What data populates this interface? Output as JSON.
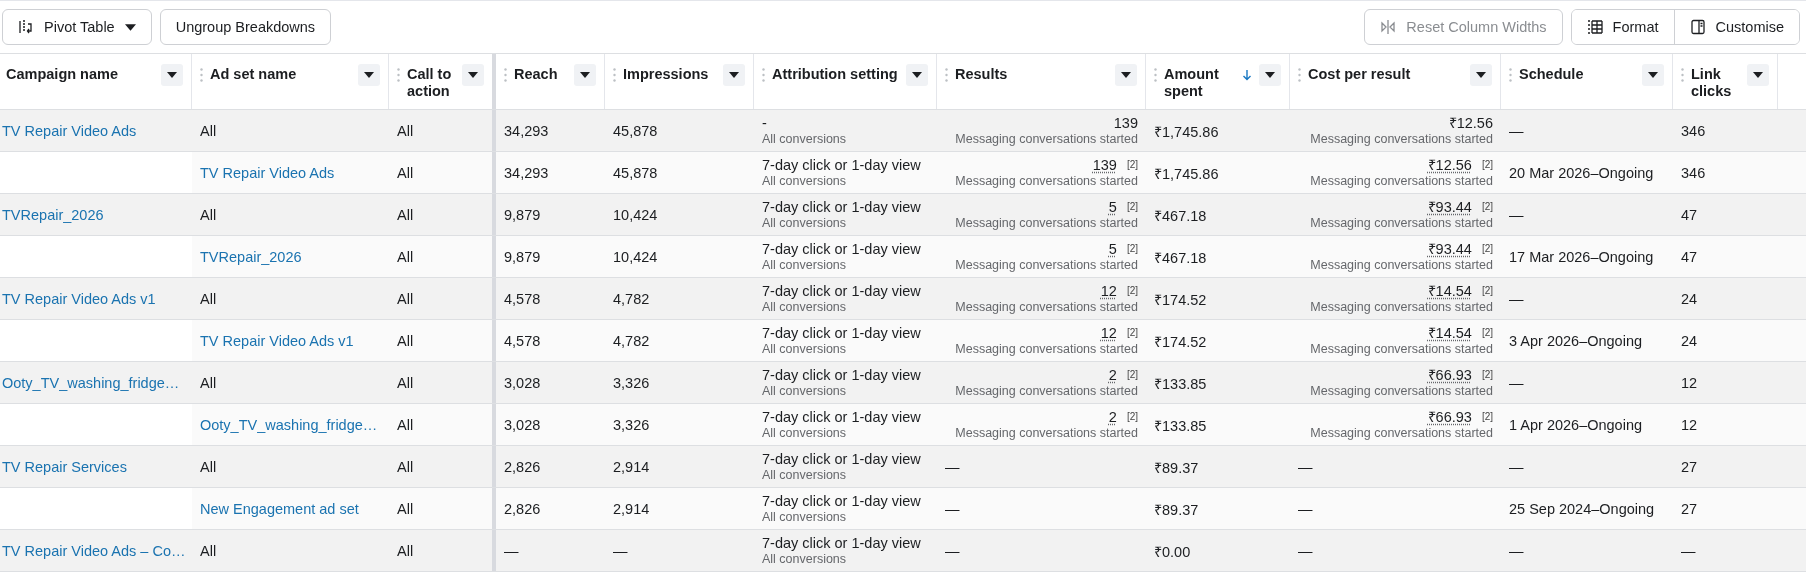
{
  "toolbar": {
    "pivot_button": "Pivot Table",
    "ungroup_button": "Ungroup Breakdowns",
    "reset_button": {
      "label": "Reset Column Widths",
      "disabled": true
    },
    "format_button": "Format",
    "customise_button": "Customise"
  },
  "table": {
    "columns": [
      {
        "label": "Campaign name",
        "sorted": false
      },
      {
        "label": "Ad set name",
        "sorted": false
      },
      {
        "label": "Call to action",
        "sorted": false
      },
      {
        "label": "Reach",
        "sorted": false
      },
      {
        "label": "Impressions",
        "sorted": false
      },
      {
        "label": "Attribution setting",
        "sorted": false
      },
      {
        "label": "Results",
        "sorted": false
      },
      {
        "label": "Amount spent",
        "sorted": true
      },
      {
        "label": "Cost per result",
        "sorted": false
      },
      {
        "label": "Schedule",
        "sorted": false
      },
      {
        "label": "Link clicks",
        "sorted": false
      }
    ],
    "rows": [
      {
        "kind": "campaign",
        "campaign": "TV Repair Video Ads",
        "ad_set": "All",
        "call_to_action": "All",
        "reach": "34,293",
        "impressions": "45,878",
        "attribution": {
          "value": "-",
          "caption": "All conversions"
        },
        "results": {
          "value": "139",
          "caption": "Messaging conversations started"
        },
        "amount_spent": "₹1,745.86",
        "cost_per_result": {
          "value": "₹12.56",
          "caption": "Messaging conversations started"
        },
        "schedule": "—",
        "link_clicks": "346"
      },
      {
        "kind": "ad_set",
        "ad_set": "TV Repair Video Ads",
        "call_to_action": "All",
        "reach": "34,293",
        "impressions": "45,878",
        "attribution": {
          "value": "7-day click or 1-day view",
          "caption": "All conversions"
        },
        "results": {
          "value": "139",
          "footnote": "[2]",
          "caption": "Messaging conversations started"
        },
        "amount_spent": "₹1,745.86",
        "cost_per_result": {
          "value": "₹12.56",
          "footnote": "[2]",
          "caption": "Messaging conversations started"
        },
        "schedule": "20 Mar 2026–Ongoing",
        "link_clicks": "346"
      },
      {
        "kind": "campaign",
        "campaign": "TVRepair_2026",
        "ad_set": "All",
        "call_to_action": "All",
        "reach": "9,879",
        "impressions": "10,424",
        "attribution": {
          "value": "7-day click or 1-day view",
          "caption": "All conversions"
        },
        "results": {
          "value": "5",
          "footnote": "[2]",
          "caption": "Messaging conversations started"
        },
        "amount_spent": "₹467.18",
        "cost_per_result": {
          "value": "₹93.44",
          "footnote": "[2]",
          "caption": "Messaging conversations started"
        },
        "schedule": "—",
        "link_clicks": "47"
      },
      {
        "kind": "ad_set",
        "ad_set": "TVRepair_2026",
        "call_to_action": "All",
        "reach": "9,879",
        "impressions": "10,424",
        "attribution": {
          "value": "7-day click or 1-day view",
          "caption": "All conversions"
        },
        "results": {
          "value": "5",
          "footnote": "[2]",
          "caption": "Messaging conversations started"
        },
        "amount_spent": "₹467.18",
        "cost_per_result": {
          "value": "₹93.44",
          "footnote": "[2]",
          "caption": "Messaging conversations started"
        },
        "schedule": "17 Mar 2026–Ongoing",
        "link_clicks": "47"
      },
      {
        "kind": "campaign",
        "campaign": "TV Repair Video Ads v1",
        "ad_set": "All",
        "call_to_action": "All",
        "reach": "4,578",
        "impressions": "4,782",
        "attribution": {
          "value": "7-day click or 1-day view",
          "caption": "All conversions"
        },
        "results": {
          "value": "12",
          "footnote": "[2]",
          "caption": "Messaging conversations started"
        },
        "amount_spent": "₹174.52",
        "cost_per_result": {
          "value": "₹14.54",
          "footnote": "[2]",
          "caption": "Messaging conversations started"
        },
        "schedule": "—",
        "link_clicks": "24"
      },
      {
        "kind": "ad_set",
        "ad_set": "TV Repair Video Ads v1",
        "call_to_action": "All",
        "reach": "4,578",
        "impressions": "4,782",
        "attribution": {
          "value": "7-day click or 1-day view",
          "caption": "All conversions"
        },
        "results": {
          "value": "12",
          "footnote": "[2]",
          "caption": "Messaging conversations started"
        },
        "amount_spent": "₹174.52",
        "cost_per_result": {
          "value": "₹14.54",
          "footnote": "[2]",
          "caption": "Messaging conversations started"
        },
        "schedule": "3 Apr 2026–Ongoing",
        "link_clicks": "24"
      },
      {
        "kind": "campaign",
        "campaign": "Ooty_TV_washing_fridge…",
        "ad_set": "All",
        "call_to_action": "All",
        "reach": "3,028",
        "impressions": "3,326",
        "attribution": {
          "value": "7-day click or 1-day view",
          "caption": "All conversions"
        },
        "results": {
          "value": "2",
          "footnote": "[2]",
          "caption": "Messaging conversations started"
        },
        "amount_spent": "₹133.85",
        "cost_per_result": {
          "value": "₹66.93",
          "footnote": "[2]",
          "caption": "Messaging conversations started"
        },
        "schedule": "—",
        "link_clicks": "12"
      },
      {
        "kind": "ad_set",
        "ad_set": "Ooty_TV_washing_fridge…",
        "call_to_action": "All",
        "reach": "3,028",
        "impressions": "3,326",
        "attribution": {
          "value": "7-day click or 1-day view",
          "caption": "All conversions"
        },
        "results": {
          "value": "2",
          "footnote": "[2]",
          "caption": "Messaging conversations started"
        },
        "amount_spent": "₹133.85",
        "cost_per_result": {
          "value": "₹66.93",
          "footnote": "[2]",
          "caption": "Messaging conversations started"
        },
        "schedule": "1 Apr 2026–Ongoing",
        "link_clicks": "12"
      },
      {
        "kind": "campaign",
        "campaign": "TV Repair Services",
        "ad_set": "All",
        "call_to_action": "All",
        "reach": "2,826",
        "impressions": "2,914",
        "attribution": {
          "value": "7-day click or 1-day view",
          "caption": "All conversions"
        },
        "results": {
          "value": "—"
        },
        "amount_spent": "₹89.37",
        "cost_per_result": {
          "value": "—"
        },
        "schedule": "—",
        "link_clicks": "27"
      },
      {
        "kind": "ad_set",
        "ad_set": "New Engagement ad set",
        "call_to_action": "All",
        "reach": "2,826",
        "impressions": "2,914",
        "attribution": {
          "value": "7-day click or 1-day view",
          "caption": "All conversions"
        },
        "results": {
          "value": "—"
        },
        "amount_spent": "₹89.37",
        "cost_per_result": {
          "value": "—"
        },
        "schedule": "25 Sep 2024–Ongoing",
        "link_clicks": "27"
      },
      {
        "kind": "campaign",
        "campaign": "TV Repair Video Ads – Co…",
        "ad_set": "All",
        "call_to_action": "All",
        "reach": "—",
        "impressions": "—",
        "attribution": {
          "value": "7-day click or 1-day view",
          "caption": "All conversions"
        },
        "results": {
          "value": "—"
        },
        "amount_spent": "₹0.00",
        "cost_per_result": {
          "value": "—"
        },
        "schedule": "—",
        "link_clicks": "—"
      }
    ]
  }
}
